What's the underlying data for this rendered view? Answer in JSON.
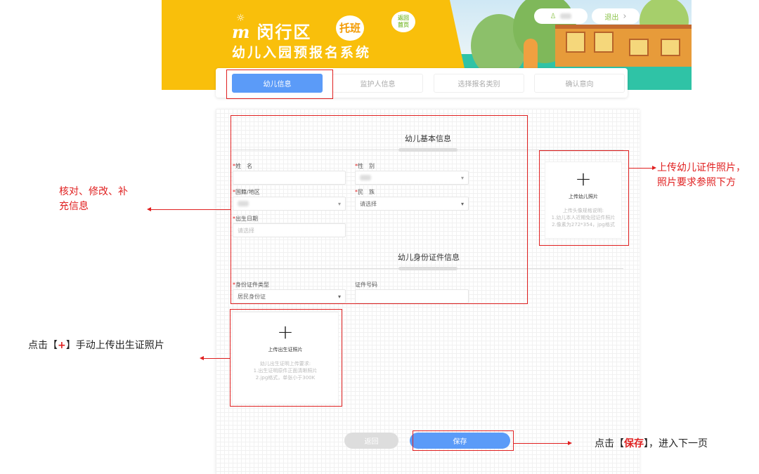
{
  "header": {
    "district": "闵行区",
    "badge": "托班",
    "system_title": "幼儿入园预报名系统",
    "home_bubble": "返回首页",
    "logout": "退出",
    "logout_chevron": "›"
  },
  "tabs": [
    {
      "label": "幼儿信息",
      "active": true
    },
    {
      "label": "监护人信息"
    },
    {
      "label": "选择报名类别"
    },
    {
      "label": "确认意向"
    }
  ],
  "form": {
    "section_basic": "幼儿基本信息",
    "name_label": "姓　名",
    "gender_label": "性　别",
    "nationality_label": "国籍/地区",
    "ethnicity_label": "民　族",
    "ethnicity_value": "请选择",
    "birthdate_label": "出生日期",
    "birthdate_placeholder": "请选择",
    "section_id": "幼儿身份证件信息",
    "id_type_label": "身份证件类型",
    "id_type_value": "居民身份证",
    "id_number_label": "证件号码",
    "required_mark": "*"
  },
  "photo_upload": {
    "plus": "+",
    "title": "上传幼儿照片",
    "desc": [
      "上传头像规格说明:",
      "1.幼儿本人近期免冠证件照片",
      "2.像素为272*354，jpg格式"
    ]
  },
  "birth_upload": {
    "plus": "+",
    "title": "上传出生证照片",
    "desc": [
      "幼儿出生证明上传要求:",
      "1.出生证明原件正面清晰照片",
      "2.jpg格式，单张小于300K"
    ]
  },
  "buttons": {
    "back": "返回",
    "save": "保存"
  },
  "annotations": {
    "verify": [
      "核对、修改、补",
      "充信息"
    ],
    "photo": [
      "上传幼儿证件照片，",
      "照片要求参照下方"
    ],
    "birth": {
      "pre": "点击【",
      "key": "+",
      "post": "】手动上传出生证照片"
    },
    "save": {
      "pre": "点击【",
      "key": "保存",
      "post": "】，进入下一页"
    }
  },
  "colors": {
    "primary": "#5b9bf8",
    "banner": "#f9bf0b",
    "annotation": "#e02020"
  }
}
